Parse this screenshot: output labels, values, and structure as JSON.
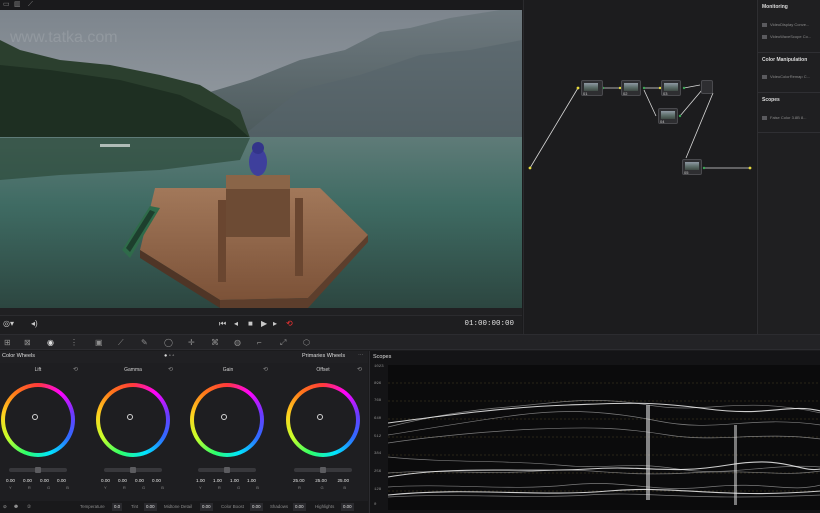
{
  "toolbar": {
    "icons": [
      "layout-icon",
      "panels-icon",
      "wand-icon"
    ]
  },
  "viewer": {
    "watermark": "www.tatka.com",
    "timecode": "01:00:00:00",
    "transport": [
      "first-frame-icon",
      "step-back-icon",
      "stop-icon",
      "play-icon",
      "step-forward-icon",
      "loop-icon"
    ]
  },
  "library": {
    "sections": [
      {
        "title": "Monitoring",
        "items": [
          "VideoDisplay Conve...",
          "VideoWaveScope Co..."
        ]
      },
      {
        "title": "Color Manipulation",
        "items": [
          "VideoColorRemap C..."
        ]
      },
      {
        "title": "Scopes",
        "items": [
          "False Color 3.8B 8..."
        ]
      }
    ]
  },
  "nodes": [
    {
      "label": "01"
    },
    {
      "label": "02"
    },
    {
      "label": "03"
    },
    {
      "label": "04"
    },
    {
      "label": "05"
    }
  ],
  "color_wheels": {
    "title": "Color Wheels",
    "mode": "Primaries Wheels",
    "wheels": [
      {
        "name": "Lift",
        "values": [
          "0.00",
          "0.00",
          "0.00",
          "0.00"
        ],
        "channels": [
          "Y",
          "R",
          "G",
          "B"
        ]
      },
      {
        "name": "Gamma",
        "values": [
          "0.00",
          "0.00",
          "0.00",
          "0.00"
        ],
        "channels": [
          "Y",
          "R",
          "G",
          "B"
        ]
      },
      {
        "name": "Gain",
        "values": [
          "1.00",
          "1.00",
          "1.00",
          "1.00"
        ],
        "channels": [
          "Y",
          "R",
          "G",
          "B"
        ]
      },
      {
        "name": "Offset",
        "values": [
          "25.00",
          "25.00",
          "25.00"
        ],
        "channels": [
          "R",
          "G",
          "B"
        ]
      }
    ],
    "bottom": [
      {
        "label": "Temperature",
        "value": "0.0"
      },
      {
        "label": "Tint",
        "value": "0.00"
      },
      {
        "label": "Midtone Detail",
        "value": "0.00"
      },
      {
        "label": "Color Boost",
        "value": "0.00"
      },
      {
        "label": "Shadows",
        "value": "0.00"
      },
      {
        "label": "Highlights",
        "value": "0.00"
      }
    ]
  },
  "scopes": {
    "title": "Scopes",
    "scale": [
      "1023",
      "896",
      "768",
      "640",
      "512",
      "384",
      "256",
      "128",
      "0"
    ]
  },
  "colors": {
    "accent": "#e0a23a",
    "playhead": "#ff3333",
    "connector": "#d8d8d8"
  }
}
